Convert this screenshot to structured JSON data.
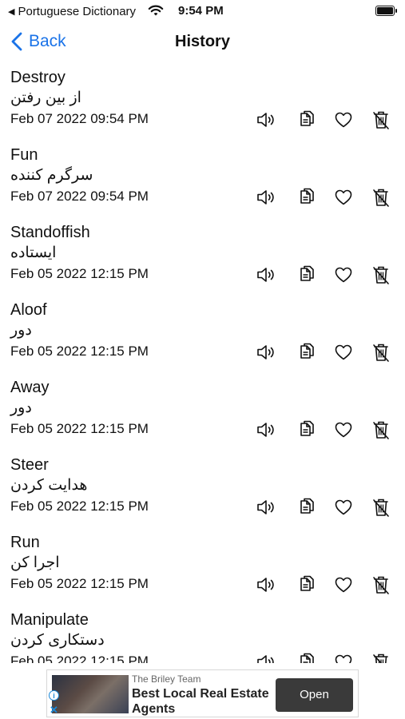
{
  "status_bar": {
    "back_app": "Portuguese Dictionary",
    "time": "9:54 PM"
  },
  "nav": {
    "back_label": "Back",
    "title": "History"
  },
  "history": [
    {
      "word": "Destroy",
      "translation": "از بین رفتن",
      "date": "Feb 07 2022 09:54 PM"
    },
    {
      "word": "Fun",
      "translation": "سرگرم کننده",
      "date": "Feb 07 2022 09:54 PM"
    },
    {
      "word": "Standoffish",
      "translation": "ایستاده",
      "date": "Feb 05 2022 12:15 PM"
    },
    {
      "word": "Aloof",
      "translation": "دور",
      "date": "Feb 05 2022 12:15 PM"
    },
    {
      "word": "Away",
      "translation": "دور",
      "date": "Feb 05 2022 12:15 PM"
    },
    {
      "word": "Steer",
      "translation": "هدایت کردن",
      "date": "Feb 05 2022 12:15 PM"
    },
    {
      "word": "Run",
      "translation": "اجرا کن",
      "date": "Feb 05 2022 12:15 PM"
    },
    {
      "word": "Manipulate",
      "translation": "دستکاری کردن",
      "date": "Feb 05 2022 12:15 PM"
    }
  ],
  "row_icons": [
    "speaker-icon",
    "copy-icon",
    "heart-icon",
    "trash-icon"
  ],
  "ad": {
    "advertiser": "The Briley Team",
    "headline": "Best Local Real Estate Agents",
    "cta": "Open"
  },
  "colors": {
    "accent": "#1a73e8",
    "text": "#111111",
    "ad_button": "#3a3a3a"
  }
}
